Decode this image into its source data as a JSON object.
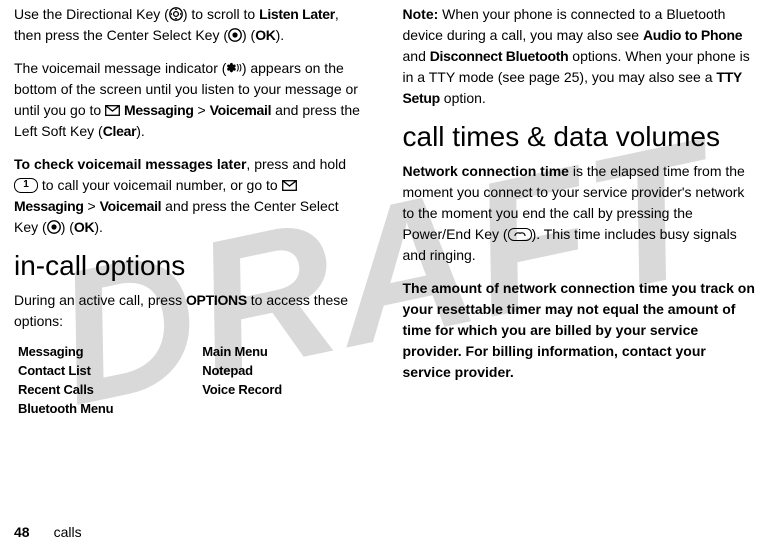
{
  "watermark": "DRAFT",
  "left": {
    "p1a": "Use the Directional Key (",
    "p1b": ") to scroll to ",
    "p1_listen": "Listen Later",
    "p1c": ", then press the Center Select Key (",
    "p1d": ") (",
    "p1_ok": "OK",
    "p1e": ").",
    "p2a": "The voicemail message indicator (",
    "p2b": ") appears on the bottom of the screen until you listen to your message or until you go to ",
    "p2_msg": "Messaging",
    "p2_gt": " > ",
    "p2_vm": "Voicemail",
    "p2c": " and press the Left Soft Key (",
    "p2_clear": "Clear",
    "p2d": ").",
    "p3a": "To check voicemail messages later",
    "p3b": ", press and hold ",
    "p3c": " to call your voicemail number, or go to ",
    "p3_msg": "Messaging",
    "p3_gt": " > ",
    "p3_vm": "Voicemail",
    "p3d": " and press the Center Select Key (",
    "p3e": ") (",
    "p3_ok": "OK",
    "p3f": ").",
    "h2": "in-call options",
    "p4a": "During an active call, press ",
    "p4_opt": "OPTIONS",
    "p4b": " to access these options:",
    "opts": {
      "a1": "Messaging",
      "b1": "Main Menu",
      "a2": "Contact List",
      "b2": "Notepad",
      "a3": "Recent Calls",
      "b3": "Voice Record",
      "a4": "Bluetooth Menu"
    }
  },
  "right": {
    "p1a": "Note:",
    "p1b": " When your phone is connected to a Bluetooth device during a call, you may also see ",
    "p1_atp": "Audio to Phone",
    "p1c": " and ",
    "p1_db": "Disconnect Bluetooth",
    "p1d": " options. When your phone is in a TTY mode (see page 25), you may also see a ",
    "p1_tty": "TTY Setup",
    "p1e": " option.",
    "h2": "call times & data volumes",
    "p2a": "Network connection time",
    "p2b": " is the elapsed time from the moment you connect to your service provider's network to the moment you end the call by pressing the Power/End Key (",
    "p2c": "). This time includes busy signals and ringing.",
    "p3": "The amount of network connection time you track on your resettable timer may not equal the amount of time for which you are billed by your service provider. For billing information, contact your service provider."
  },
  "footer": {
    "page": "48",
    "section": "calls"
  },
  "keycap1": "1",
  "vm_indicator": "✽"
}
